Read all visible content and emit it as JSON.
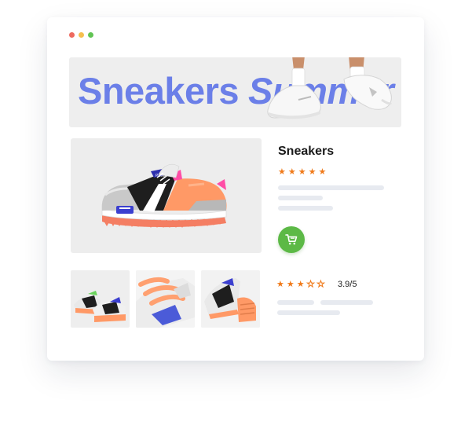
{
  "window": {
    "traffic_lights": [
      "close",
      "minimize",
      "maximize"
    ]
  },
  "banner": {
    "title_word_1": "Sneakers",
    "title_word_2": "Summer",
    "accent_color": "#6b7fe8"
  },
  "product": {
    "title": "Sneakers",
    "top_rating_stars": 5,
    "cart_icon": "shopping-cart-icon",
    "cart_color": "#5cb946"
  },
  "reviews": {
    "stars_filled": 3,
    "stars_total": 5,
    "score_text": "3.9/5"
  },
  "thumbnails": [
    {
      "name": "thumbnail-pair"
    },
    {
      "name": "thumbnail-laces"
    },
    {
      "name": "thumbnail-angle"
    }
  ],
  "colors": {
    "star": "#f07a1a",
    "skeleton": "#e7eaf0"
  }
}
